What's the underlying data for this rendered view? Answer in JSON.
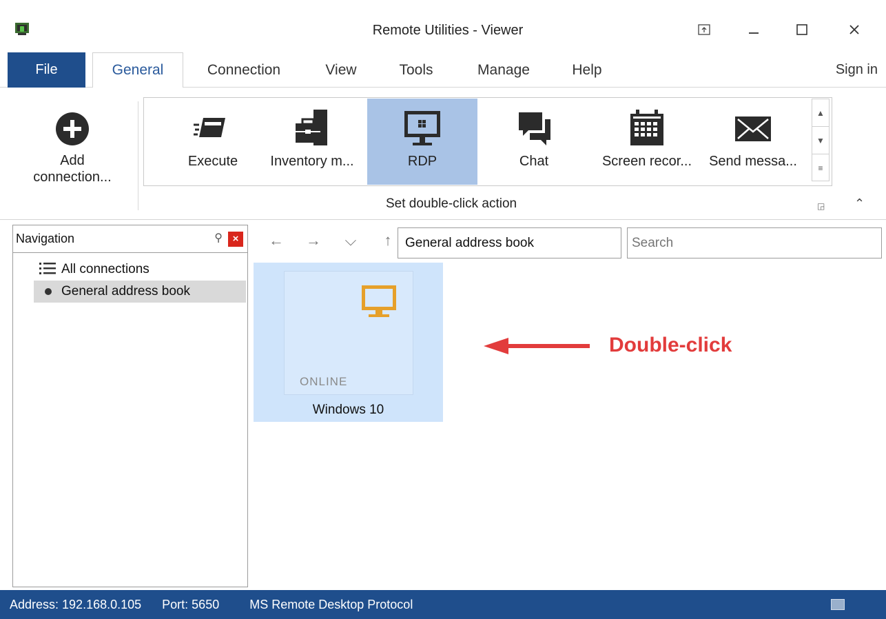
{
  "window": {
    "title": "Remote Utilities - Viewer",
    "buttons": [
      "restore-up-icon",
      "minimize-icon",
      "maximize-icon",
      "close-icon"
    ]
  },
  "menu": {
    "file": "File",
    "tabs": [
      "General",
      "Connection",
      "View",
      "Tools",
      "Manage",
      "Help"
    ],
    "active_tab": "General",
    "sign_in": "Sign in"
  },
  "ribbon": {
    "add_connection_line1": "Add",
    "add_connection_line2": "connection...",
    "actions": [
      {
        "label": "Execute",
        "icon": "execute-icon",
        "selected": false
      },
      {
        "label": "Inventory m...",
        "icon": "inventory-icon",
        "selected": false
      },
      {
        "label": "RDP",
        "icon": "rdp-monitor-icon",
        "selected": true
      },
      {
        "label": "Chat",
        "icon": "chat-icon",
        "selected": false
      },
      {
        "label": "Screen recor...",
        "icon": "calendar-icon",
        "selected": false
      },
      {
        "label": "Send messa...",
        "icon": "envelope-icon",
        "selected": false
      }
    ],
    "group_caption": "Set double-click action"
  },
  "navigation": {
    "title": "Navigation",
    "items": [
      {
        "label": "All connections",
        "icon": "list-icon",
        "selected": false
      },
      {
        "label": "General address book",
        "icon": "bullet-icon",
        "selected": true
      }
    ]
  },
  "toolbar": {
    "address": "General address book",
    "search_placeholder": "Search"
  },
  "connection": {
    "name": "Windows 10",
    "status": "ONLINE"
  },
  "annotation": {
    "text": "Double-click",
    "color": "#e23c3c"
  },
  "statusbar": {
    "address": "Address: 192.168.0.105",
    "port": "Port: 5650",
    "protocol": "MS Remote Desktop Protocol"
  },
  "colors": {
    "accent": "#1f4e8c",
    "selection": "#a9c3e6",
    "tile": "#cfe4fb",
    "monitor": "#e6a02a"
  }
}
